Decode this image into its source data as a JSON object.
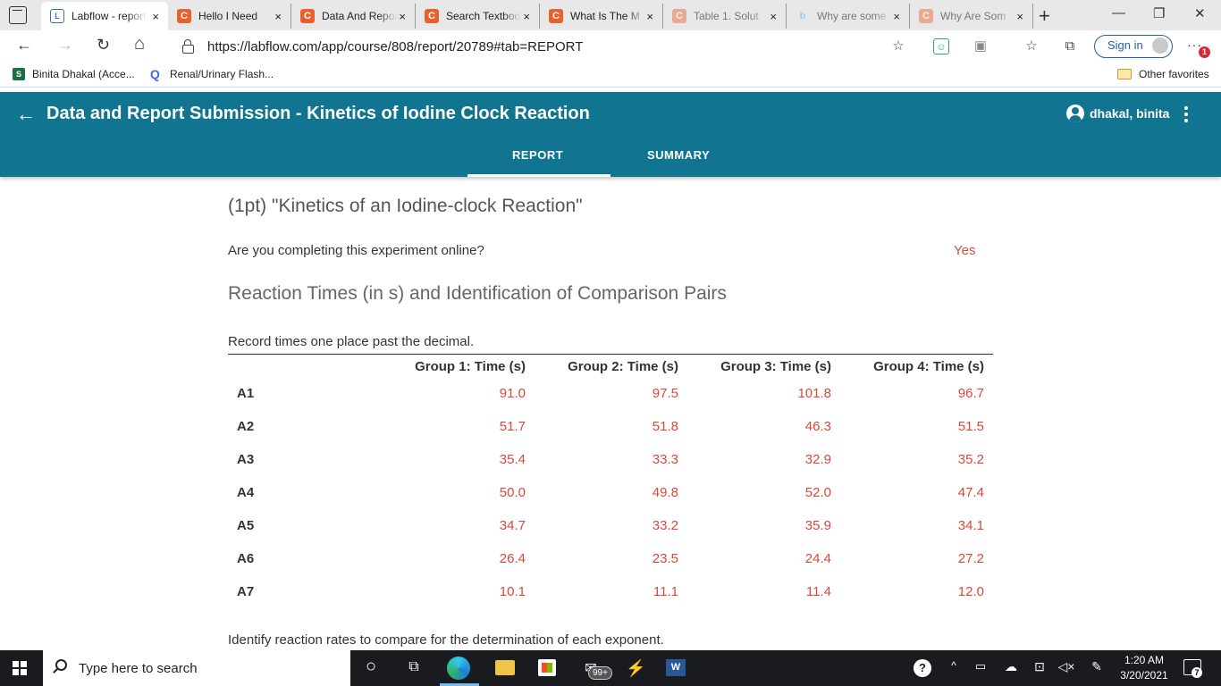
{
  "browser": {
    "tabs": [
      {
        "label": "Labflow - report",
        "icon": "labflow-icon",
        "active": true
      },
      {
        "label": "Hello I Need",
        "icon": "chegg-icon"
      },
      {
        "label": "Data And Report",
        "icon": "chegg-icon"
      },
      {
        "label": "Search Textbook",
        "icon": "chegg-icon"
      },
      {
        "label": "What Is The M",
        "icon": "chegg-icon"
      },
      {
        "label": "Table 1. Solut",
        "icon": "chegg-icon",
        "faded": true
      },
      {
        "label": "Why are some",
        "icon": "bing-icon",
        "faded": true
      },
      {
        "label": "Why Are Som",
        "icon": "chegg-icon",
        "faded": true
      }
    ],
    "tab_close": "×",
    "new_tab": "+",
    "window": {
      "minimize": "—",
      "restore": "❐",
      "close": "✕"
    },
    "nav": {
      "back": "←",
      "forward": "→",
      "refresh": "↻",
      "home": "⌂"
    },
    "url": "https://labflow.com/app/course/808/report/20789#tab=REPORT",
    "sign_in": "Sign in",
    "more": "···",
    "notification_count": "1",
    "favorites": [
      {
        "label": "Binita Dhakal (Acce...",
        "icon": "S"
      },
      {
        "label": "Renal/Urinary Flash...",
        "icon": "Q"
      }
    ],
    "other_favorites": "Other favorites"
  },
  "app": {
    "title": "Data and Report Submission - Kinetics of Iodine Clock Reaction",
    "user": "dhakal, binita",
    "tabs": [
      "REPORT",
      "SUMMARY"
    ],
    "active_tab": "REPORT"
  },
  "report": {
    "question_title": "(1pt) \"Kinetics of an Iodine-clock Reaction\"",
    "online_question": "Are you completing this experiment online?",
    "online_answer": "Yes",
    "section_title": "Reaction Times (in s) and Identification of Comparison Pairs",
    "table_note": "Record times one place past the decimal.",
    "columns": [
      "Group 1: Time (s)",
      "Group 2: Time (s)",
      "Group 3: Time (s)",
      "Group 4: Time (s)"
    ],
    "rows": [
      {
        "label": "A1",
        "values": [
          "91.0",
          "97.5",
          "101.8",
          "96.7"
        ]
      },
      {
        "label": "A2",
        "values": [
          "51.7",
          "51.8",
          "46.3",
          "51.5"
        ]
      },
      {
        "label": "A3",
        "values": [
          "35.4",
          "33.3",
          "32.9",
          "35.2"
        ]
      },
      {
        "label": "A4",
        "values": [
          "50.0",
          "49.8",
          "52.0",
          "47.4"
        ]
      },
      {
        "label": "A5",
        "values": [
          "34.7",
          "33.2",
          "35.9",
          "34.1"
        ]
      },
      {
        "label": "A6",
        "values": [
          "26.4",
          "23.5",
          "24.4",
          "27.2"
        ]
      },
      {
        "label": "A7",
        "values": [
          "10.1",
          "11.1",
          "11.4",
          "12.0"
        ]
      }
    ],
    "footnote": "Identify reaction rates to compare for the determination of each exponent."
  },
  "taskbar": {
    "search_placeholder": "Type here to search",
    "mail_badge": "99+",
    "word_label": "W",
    "time": "1:20 AM",
    "date": "3/20/2021",
    "notification_count": "7"
  },
  "colors": {
    "header": "#117591",
    "answer": "#d9483b"
  }
}
